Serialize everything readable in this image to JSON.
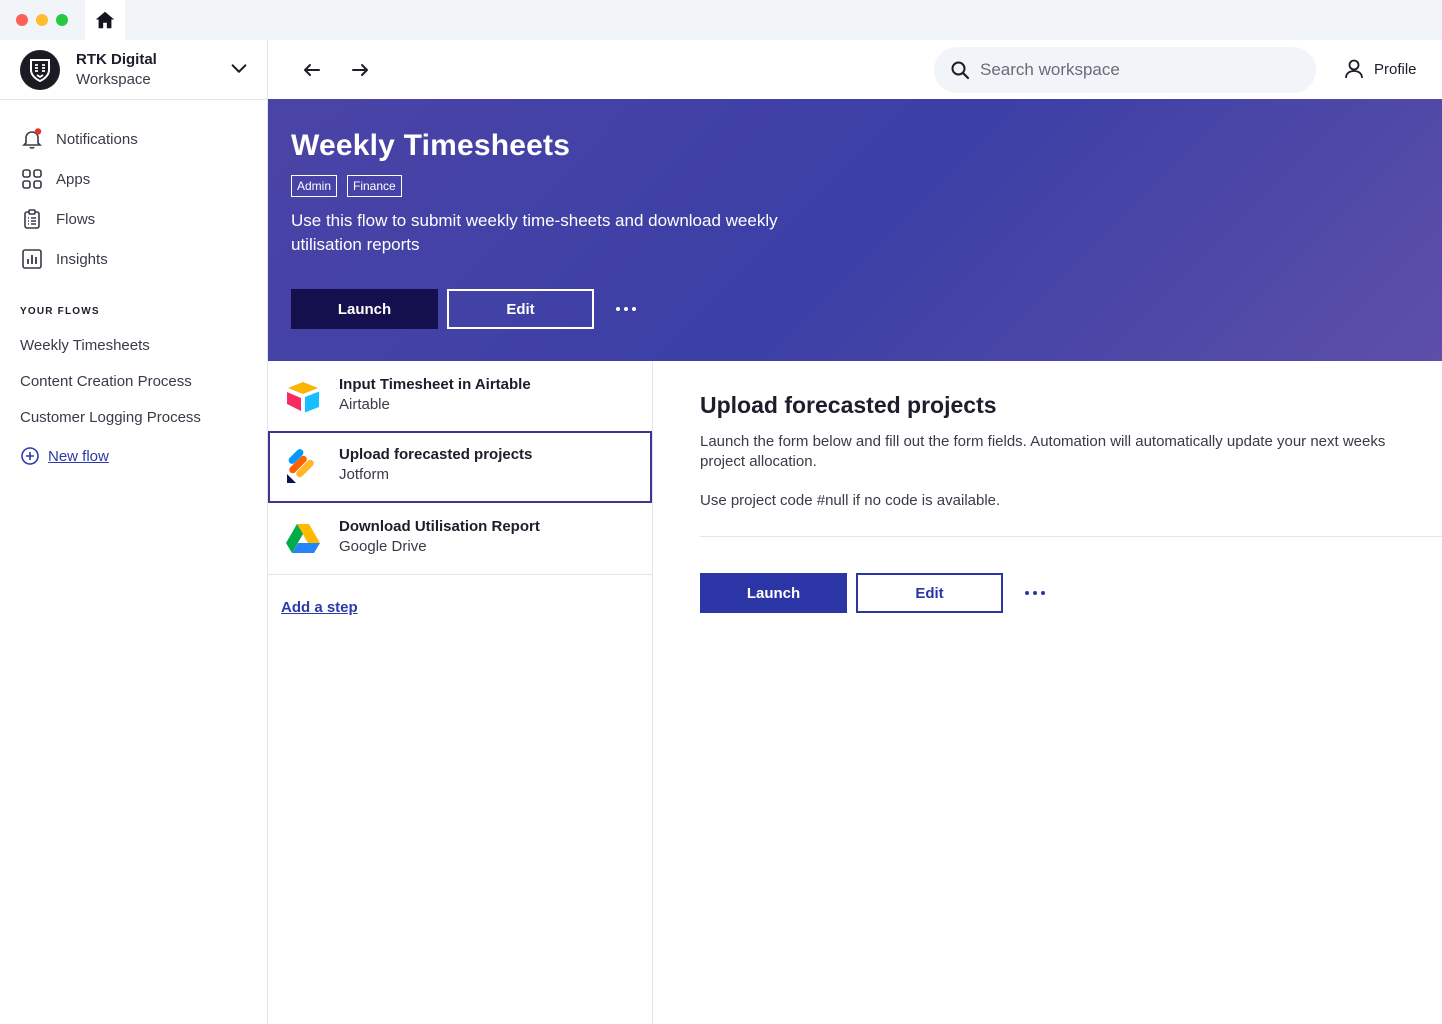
{
  "workspace": {
    "name": "RTK Digital",
    "subtitle": "Workspace"
  },
  "sidebar": {
    "nav": [
      {
        "label": "Notifications",
        "icon": "bell-icon"
      },
      {
        "label": "Apps",
        "icon": "apps-grid-icon"
      },
      {
        "label": "Flows",
        "icon": "clipboard-list-icon"
      },
      {
        "label": "Insights",
        "icon": "bar-chart-icon"
      }
    ],
    "section_label": "YOUR FLOWS",
    "flows": [
      "Weekly Timesheets",
      "Content Creation Process",
      "Customer Logging Process"
    ],
    "new_flow_label": "New flow"
  },
  "topbar": {
    "search_placeholder": "Search workspace",
    "profile_label": "Profile"
  },
  "hero": {
    "title": "Weekly Timesheets",
    "tags": [
      "Admin",
      "Finance"
    ],
    "description": "Use this flow to submit weekly time-sheets and download weekly utilisation reports",
    "launch_label": "Launch",
    "edit_label": "Edit"
  },
  "steps": [
    {
      "title": "Input Timesheet in Airtable",
      "app": "Airtable",
      "icon": "airtable-logo"
    },
    {
      "title": "Upload forecasted projects",
      "app": "Jotform",
      "icon": "jotform-logo",
      "selected": true
    },
    {
      "title": "Download Utilisation Report",
      "app": "Google Drive",
      "icon": "google-drive-logo"
    }
  ],
  "add_step_label": "Add a step",
  "detail": {
    "title": "Upload forecasted projects",
    "description": "Launch the form below and fill out the form fields. Automation will automatically update your next weeks project allocation.",
    "note": "Use project code #null if no code is available.",
    "launch_label": "Launch",
    "edit_label": "Edit"
  },
  "colors": {
    "accent": "#2c35a6",
    "hero_dark_button": "#140f4d",
    "notification_dot": "#e5322d"
  }
}
